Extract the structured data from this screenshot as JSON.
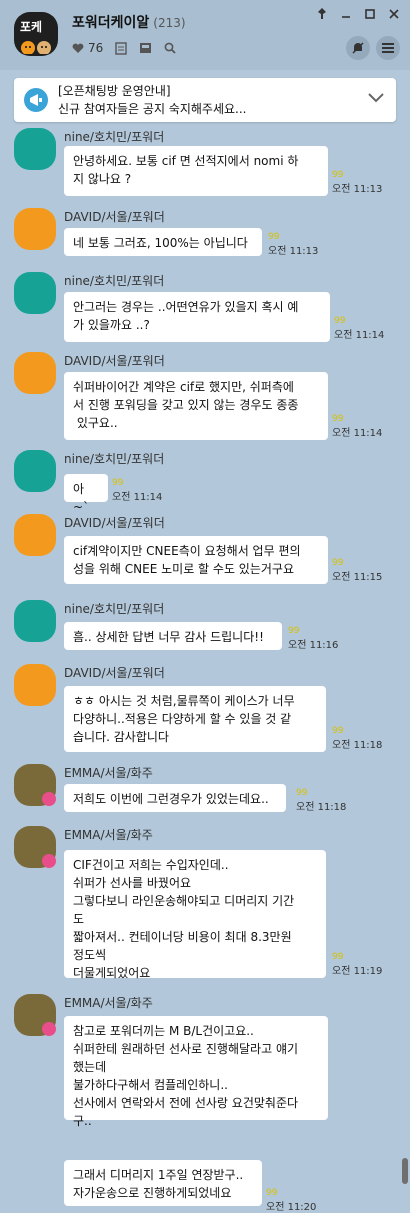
{
  "header": {
    "avatar_text": "포케",
    "title": "포워더케이알",
    "count": "(213)",
    "members": "76"
  },
  "notice": {
    "title": "[오픈채팅방 운영안내]",
    "text": "신규 참여자들은 공지 숙지해주세요..."
  },
  "messages": [
    {
      "sender": "nine/호치민/포워더",
      "text": "안녕하세요. 보통 cif 면 선적지에서 nomi 하\n지 않나요 ?",
      "read": "99",
      "time": "오전 11:13"
    },
    {
      "sender": "DAVID/서울/포워더",
      "text": "네 보통 그러죠, 100%는 아닙니다",
      "read": "99",
      "time": "오전 11:13"
    },
    {
      "sender": "nine/호치민/포워더",
      "text": "안그러는 경우는 ..어떤연유가 있을지 혹시 예\n가 있을까요 ..?",
      "read": "99",
      "time": "오전 11:14"
    },
    {
      "sender": "DAVID/서울/포워더",
      "text": "쉬퍼바이어간 계약은 cif로 했지만, 쉬퍼측에\n서 진행 포워딩을 갖고 있지 않는 경우도 종종\n 있구요..",
      "read": "99",
      "time": "오전 11:14"
    },
    {
      "sender": "nine/호치민/포워더",
      "text": "아 ~`",
      "read": "99",
      "time": "오전 11:14"
    },
    {
      "sender": "DAVID/서울/포워더",
      "text": "cif계약이지만 CNEE측이 요청해서 업무 편의\n성을 위해 CNEE 노미로 할 수도 있는거구요",
      "read": "99",
      "time": "오전 11:15"
    },
    {
      "sender": "nine/호치민/포워더",
      "text": "흠.. 상세한 답변 너무 감사 드립니다!!",
      "read": "99",
      "time": "오전 11:16"
    },
    {
      "sender": "DAVID/서울/포워더",
      "text": "ㅎㅎ 아시는 것 처럼,물류쪽이 케이스가 너무\n다양하니..적용은 다양하게 할 수 있을 것 같\n습니다. 감사합니다",
      "read": "99",
      "time": "오전 11:18"
    },
    {
      "sender": "EMMA/서울/화주",
      "text": "저희도 이번에 그런경우가 있었는데요..",
      "read": "99",
      "time": "오전 11:18"
    },
    {
      "sender": "EMMA/서울/화주",
      "text": "CIF건이고 저희는 수입자인데..\n쉬퍼가 선사를 바꿨어요\n그렇다보니 라인운송해야되고 디머리지 기간\n도\n짧아져서.. 컨테이너당 비용이 최대 8.3만원\n정도씩\n더물게되었어요",
      "read": "99",
      "time": "오전 11:19"
    },
    {
      "sender": "EMMA/서울/화주",
      "text": "참고로 포워더끼는 M B/L건이고요..\n쉬퍼한테 원래하던 선사로 진행해달라고 얘기\n했는데\n불가하다구해서 컴플레인하니..\n선사에서 연락와서 전에 선사랑 요건맞춰준다\n구..",
      "read": "",
      "time": ""
    },
    {
      "sender": "",
      "text": "그래서 디머리지 1주일 연장받구..\n자가운송으로 진행하게되었네요",
      "read": "99",
      "time": "오전 11:20"
    }
  ]
}
